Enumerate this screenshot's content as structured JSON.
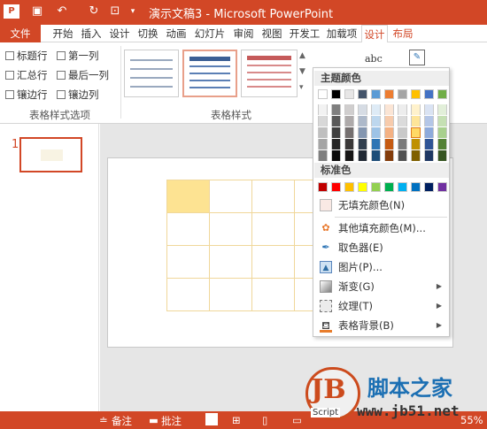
{
  "window": {
    "title": "演示文稿3 - Microsoft PowerPoint"
  },
  "quick_access": [
    "ppt-logo-icon",
    "save-icon",
    "undo-icon",
    "redo-icon",
    "present-icon",
    "customize-icon"
  ],
  "tabs": [
    "文件",
    "开始",
    "插入",
    "设计",
    "切换",
    "动画",
    "幻灯片",
    "审阅",
    "视图",
    "开发工",
    "加载项",
    "设计",
    "布局"
  ],
  "ribbon": {
    "checkboxes": [
      "标题行",
      "第一列",
      "汇总行",
      "最后一列",
      "镶边行",
      "镶边列"
    ],
    "group_options_label": "表格样式选项",
    "group_styles_label": "表格样式"
  },
  "slides": {
    "number": "1"
  },
  "dropdown": {
    "theme_colors_header": "主题颜色",
    "theme_top_row": [
      "#ffffff",
      "#000000",
      "#e7e6e6",
      "#44546a",
      "#5b9bd5",
      "#ed7d31",
      "#a5a5a5",
      "#ffc000",
      "#4472c4",
      "#70ad47"
    ],
    "theme_shades": [
      [
        "#f2f2f2",
        "#7f7f7f",
        "#d0cece",
        "#d6dce4",
        "#deebf6",
        "#fbe5d5",
        "#ededed",
        "#fff2cc",
        "#dae3f3",
        "#e2efd9"
      ],
      [
        "#d8d8d8",
        "#595959",
        "#aeaaaa",
        "#adb9ca",
        "#bdd7ee",
        "#f7cbac",
        "#dbdbdb",
        "#fee599",
        "#b4c6e7",
        "#c5e0b3"
      ],
      [
        "#bfbfbf",
        "#3f3f3f",
        "#757070",
        "#8496b0",
        "#9dc3e6",
        "#f4b183",
        "#c9c9c9",
        "#ffd965",
        "#8eaadb",
        "#a8d08d"
      ],
      [
        "#a5a5a5",
        "#262626",
        "#3a3838",
        "#323f4f",
        "#2e75b5",
        "#c55a11",
        "#7b7b7b",
        "#bf9000",
        "#2f5496",
        "#538135"
      ],
      [
        "#7f7f7f",
        "#0c0c0c",
        "#171616",
        "#222a35",
        "#1e4e79",
        "#833c0b",
        "#525252",
        "#7f6000",
        "#1f3864",
        "#375623"
      ]
    ],
    "standard_header": "标准色",
    "standard_colors": [
      "#c00000",
      "#ff0000",
      "#ffc000",
      "#ffff00",
      "#92d050",
      "#00b050",
      "#00b0f0",
      "#0070c0",
      "#002060",
      "#7030a0"
    ],
    "no_fill": "无填充颜色(N)",
    "items": [
      {
        "label": "其他填充颜色(M)...",
        "icon": "color-wheel-icon"
      },
      {
        "label": "取色器(E)",
        "icon": "eyedropper-icon"
      },
      {
        "label": "图片(P)...",
        "icon": "picture-icon"
      },
      {
        "label": "渐变(G)",
        "icon": "gradient-icon",
        "submenu": true
      },
      {
        "label": "纹理(T)",
        "icon": "texture-icon",
        "submenu": true
      },
      {
        "label": "表格背景(B)",
        "icon": "table-background-icon",
        "submenu": true
      }
    ]
  },
  "statusbar": {
    "notes": "备注",
    "comments": "批注",
    "zoom": "55%"
  },
  "watermark": {
    "logo": "JB",
    "script": "Script",
    "brand": "脚本之家",
    "url": "www.jb51.net"
  }
}
